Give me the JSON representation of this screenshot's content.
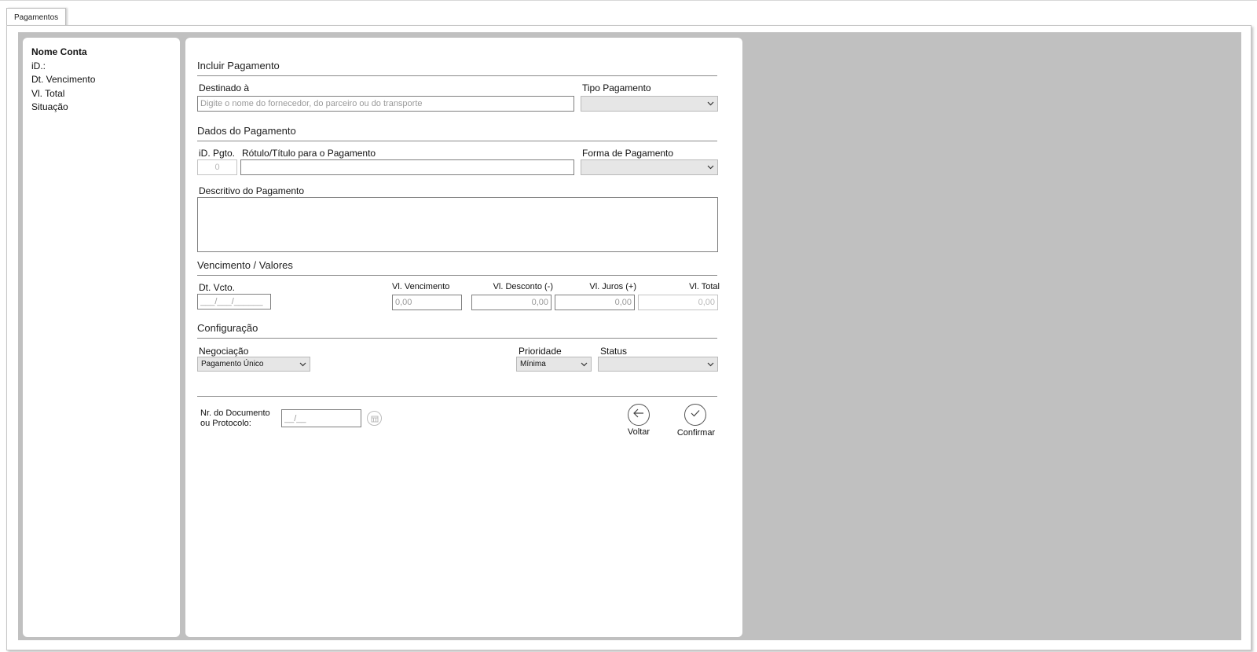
{
  "tab": {
    "label": "Pagamentos"
  },
  "sidebar": {
    "title": "Nome Conta",
    "items": [
      "iD.:",
      "Dt. Vencimento",
      "Vl. Total",
      "Situação"
    ]
  },
  "form": {
    "incluir": {
      "title": "Incluir Pagamento",
      "destinado_label": "Destinado à",
      "destinado_placeholder": "Digite o nome do fornecedor, do parceiro ou do transporte",
      "tipo_label": "Tipo Pagamento",
      "tipo_value": ""
    },
    "dados": {
      "title": "Dados do Pagamento",
      "id_label": "iD. Pgto.",
      "id_value": "0",
      "rotulo_label": "Rótulo/Título para o Pagamento",
      "rotulo_value": "",
      "forma_label": "Forma de Pagamento",
      "forma_value": "",
      "descritivo_label": "Descritivo do Pagamento",
      "descritivo_value": ""
    },
    "vencimento": {
      "title": "Vencimento / Valores",
      "dt_label": "Dt. Vcto.",
      "dt_placeholder": "___/___/______",
      "vl_venc_label": "Vl. Vencimento",
      "vl_venc_value": "0,00",
      "vl_desc_label": "Vl. Desconto (-)",
      "vl_desc_value": "0,00",
      "vl_juros_label": "Vl. Juros (+)",
      "vl_juros_value": "0,00",
      "vl_total_label": "Vl. Total",
      "vl_total_value": "0,00"
    },
    "config": {
      "title": "Configuração",
      "negociacao_label": "Negociação",
      "negociacao_value": "Pagamento Único",
      "prioridade_label": "Prioridade",
      "prioridade_value": "Mínima",
      "status_label": "Status",
      "status_value": ""
    },
    "footer": {
      "doc_label_1": "Nr. do Documento",
      "doc_label_2": "ou Protocolo:",
      "doc_placeholder": "__/__",
      "voltar_label": "Voltar",
      "confirmar_label": "Confirmar"
    }
  },
  "icons": {
    "select_chevron": "chevron-down-icon",
    "voltar": "arrow-left-icon",
    "confirmar": "check-icon",
    "doc_lookup": "calendar-icon"
  }
}
